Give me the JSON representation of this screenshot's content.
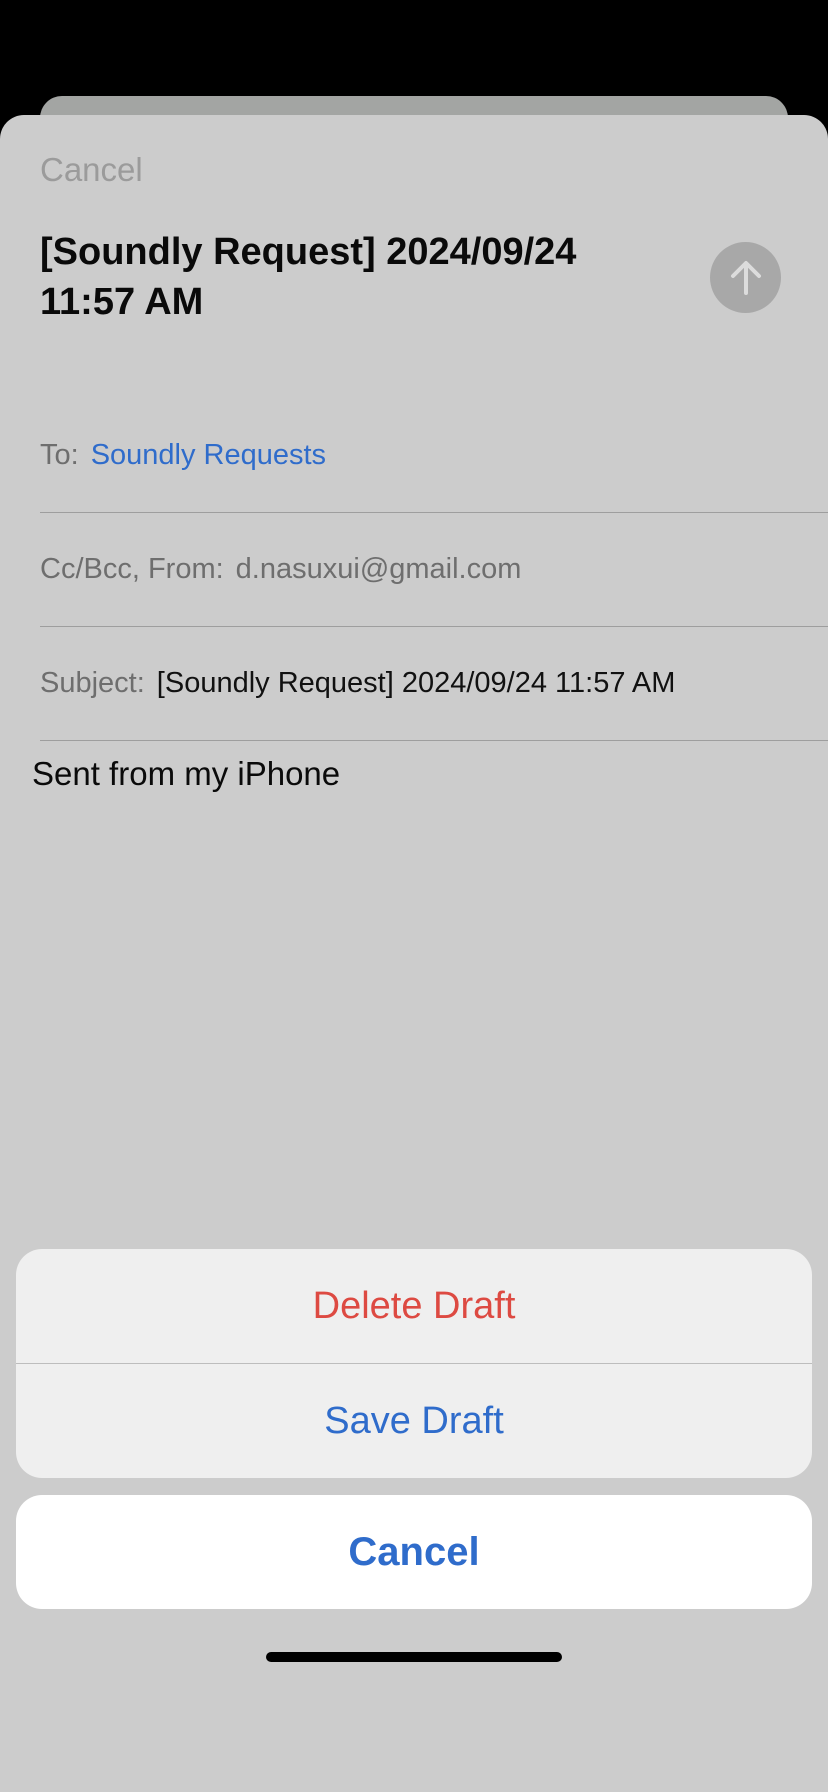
{
  "compose": {
    "cancel_label": "Cancel",
    "title": "[Soundly Request] 2024/09/24 11:57 AM",
    "send_icon": "arrow-up-icon",
    "to_label": "To:",
    "to_value": "Soundly Requests",
    "ccbcc_label": "Cc/Bcc, From:",
    "from_value": "d.nasuxui@gmail.com",
    "subject_label": "Subject:",
    "subject_value": "[Soundly Request] 2024/09/24 11:57 AM",
    "body": "Sent from my iPhone"
  },
  "action_sheet": {
    "delete_label": "Delete Draft",
    "save_label": "Save Draft",
    "cancel_label": "Cancel"
  },
  "colors": {
    "accent": "#2f6ccb",
    "destructive": "#dd4a42",
    "sheet_background": "#cccccc",
    "send_button": "#a8a8a8"
  }
}
